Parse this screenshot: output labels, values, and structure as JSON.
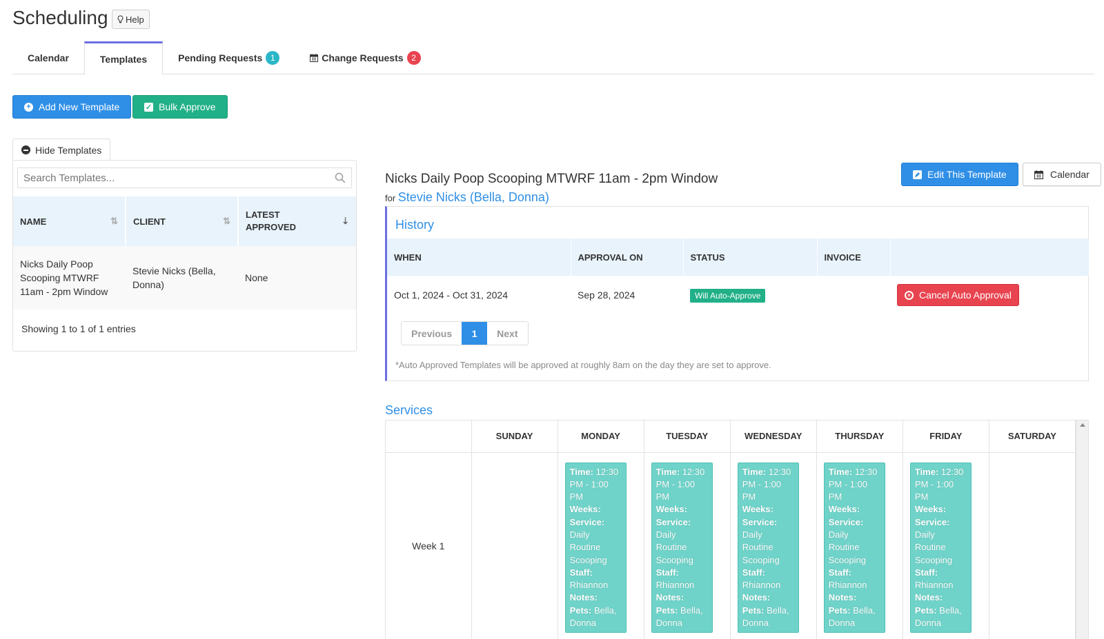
{
  "page": {
    "title": "Scheduling",
    "help_label": "Help"
  },
  "tabs": [
    {
      "label": "Calendar"
    },
    {
      "label": "Templates",
      "active": true
    },
    {
      "label": "Pending Requests",
      "badge": "1"
    },
    {
      "label": "Change Requests",
      "badge": "2"
    }
  ],
  "toolbar": {
    "add_label": "Add New Template",
    "bulk_label": "Bulk Approve"
  },
  "templates_panel": {
    "hide_label": "Hide Templates",
    "search_placeholder": "Search Templates...",
    "columns": [
      "NAME",
      "CLIENT",
      "LATEST APPROVED"
    ],
    "rows": [
      {
        "name": "Nicks Daily Poop Scooping MTWRF 11am - 2pm Window",
        "client": "Stevie Nicks (Bella, Donna)",
        "latest": "None"
      }
    ],
    "showing": "Showing 1 to 1 of 1 entries"
  },
  "template": {
    "title": "Nicks Daily Poop Scooping MTWRF 11am - 2pm Window",
    "for_label": "for",
    "client_link": "Stevie Nicks (Bella, Donna)",
    "edit_label": "Edit This Template",
    "calendar_label": "Calendar"
  },
  "history": {
    "title": "History",
    "columns": [
      "WHEN",
      "APPROVAL ON",
      "STATUS",
      "INVOICE",
      ""
    ],
    "rows": [
      {
        "when": "Oct 1, 2024 - Oct 31, 2024",
        "approval_on": "Sep 28, 2024",
        "status": "Will Auto-Approve",
        "invoice": "",
        "action": "Cancel Auto Approval"
      }
    ],
    "pagination": {
      "previous": "Previous",
      "current": "1",
      "next": "Next"
    },
    "note": "*Auto Approved Templates will be approved at roughly 8am on the day they are set to approve."
  },
  "services": {
    "title": "Services",
    "days": [
      "SUNDAY",
      "MONDAY",
      "TUESDAY",
      "WEDNESDAY",
      "THURSDAY",
      "FRIDAY",
      "SATURDAY"
    ],
    "week_label": "Week 1",
    "card": {
      "time_label": "Time:",
      "time_value": "12:30 PM - 1:00 PM",
      "weeks_label": "Weeks:",
      "service_label": "Service:",
      "service_value": "Daily Routine Scooping",
      "staff_label": "Staff:",
      "staff_value": "Rhiannon",
      "notes_label": "Notes:",
      "pets_label": "Pets:",
      "pets_value": "Bella, Donna"
    }
  },
  "colors": {
    "primary": "#2f8fe6",
    "success": "#21b088",
    "danger": "#e8444f",
    "card": "#6fd3c9",
    "tab_accent": "#6c6fe0"
  }
}
